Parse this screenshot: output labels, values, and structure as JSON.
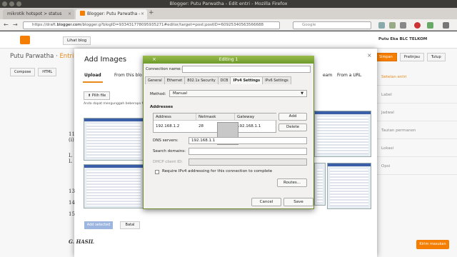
{
  "window": {
    "title": "Blogger: Putu Parwatha - Edit entri - Mozilla Firefox"
  },
  "tabs": [
    {
      "label": "mikrotik hotspot > status"
    },
    {
      "label": "Blogger: Putu Parwatha -"
    }
  ],
  "url": {
    "prefix": "https://draft.",
    "domain": "blogger.com",
    "rest": "/blogger.g?blogID=933431778095935271#editor/target=post;postID=60925340563566688"
  },
  "search": {
    "placeholder": "Google"
  },
  "blogger": {
    "view_blog": "Lihat blog",
    "user": "Putu Eka BLC TELKOM",
    "title_main": "Putu Parwatha",
    "title_sep": " · ",
    "title_entri": "Entri",
    "compose": "Compose",
    "html": "HTML",
    "buttons": {
      "publish": "Simpan",
      "preview": "Pratinjau",
      "close": "Tutup"
    },
    "sidebar": [
      "Setelan entri",
      "Label",
      "Jadwal",
      "Tautan permanen",
      "Lokasi",
      "Opsi"
    ],
    "submit": "Kirim masukan"
  },
  "add_images": {
    "title": "Add Images",
    "tabs": {
      "upload": "Upload",
      "from_blog": "From this blo",
      "partial": "eam",
      "from_url": "From a URL"
    },
    "choose_files": "Pilih file",
    "hint": "Anda dapat mengunggah beberapa fi",
    "add_selected": "Add selected",
    "cancel": "Batal",
    "doc_numbers": [
      "11",
      "(i)",
      "L",
      "L",
      "13",
      "14",
      "15"
    ],
    "doc_heading": "G. HASIL"
  },
  "edit_dialog": {
    "title": "Editing 1",
    "connection_name_label": "Connection name:",
    "connection_name_value": "",
    "tabs": [
      "General",
      "Ethernet",
      "802.1x Security",
      "DCB",
      "IPv4 Settings",
      "IPv6 Settings"
    ],
    "method_label": "Method:",
    "method_value": "Manual",
    "addresses_label": "Addresses",
    "columns": [
      "Address",
      "Netmask",
      "Gateway"
    ],
    "rows": [
      {
        "address": "192.168.1.2",
        "netmask": "28",
        "gateway": "192.168.1.1"
      }
    ],
    "add": "Add",
    "delete": "Delete",
    "dns_label": "DNS servers:",
    "dns_value": "192.168.1.1",
    "search_domains_label": "Search domains:",
    "search_domains_value": "",
    "dhcp_client_label": "DHCP client ID:",
    "dhcp_client_value": "",
    "require_ipv4": "Require IPv4 addressing for this connection to complete",
    "routes": "Routes...",
    "cancel": "Cancel",
    "save": "Save"
  }
}
